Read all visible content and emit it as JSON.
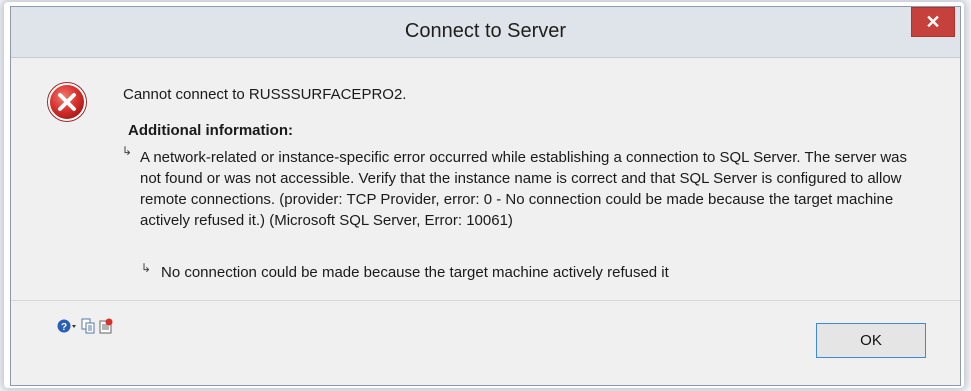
{
  "dialog": {
    "title": "Connect to Server",
    "close_label": "✕"
  },
  "message": {
    "main": "Cannot connect to RUSSSURFACEPRO2.",
    "additional_header": "Additional information:",
    "detail": "A network-related or instance-specific error occurred while establishing a connection to SQL Server. The server was not found or was not accessible. Verify that the instance name is correct and that SQL Server is configured to allow remote connections. (provider: TCP Provider, error: 0 - No connection could be made because the target machine actively refused it.) (Microsoft SQL Server, Error: 10061)",
    "inner": "No connection could be made because the target machine actively refused it"
  },
  "footer": {
    "ok_label": "OK"
  },
  "icons": {
    "error": "error-icon",
    "arrow": "sub-arrow-icon",
    "help": "help-icon",
    "copy": "copy-icon",
    "details": "show-details-icon"
  },
  "colors": {
    "close_button": "#c6413b",
    "error_icon": "#d9302c",
    "ok_border": "#3c8ad8"
  }
}
